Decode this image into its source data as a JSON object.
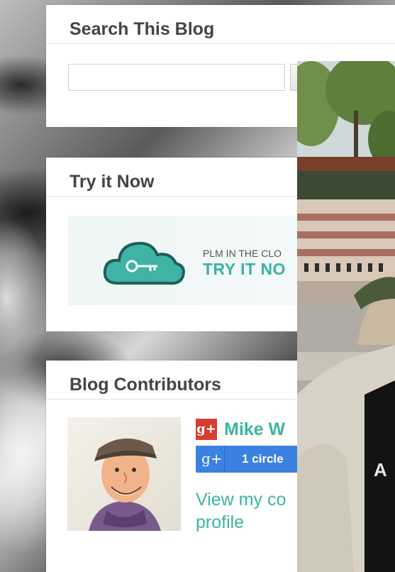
{
  "search_widget": {
    "title": "Search This Blog",
    "input_value": ""
  },
  "try_widget": {
    "title": "Try it Now",
    "banner": {
      "tagline": "PLM IN THE CLO",
      "cta": "TRY IT NO"
    }
  },
  "contributors_widget": {
    "title": "Blog Contributors",
    "contributor": {
      "name": "Mike W",
      "gplus_circle_label": "1 circle",
      "profile_link_line1": "View my co",
      "profile_link_line2": "profile"
    }
  },
  "colors": {
    "accent_teal": "#3bb59e",
    "gplus_red": "#d73d32",
    "gplus_blue": "#3b82e0",
    "heading_gray": "#444444"
  },
  "photo_overlay": {
    "shirt_text": "A"
  }
}
